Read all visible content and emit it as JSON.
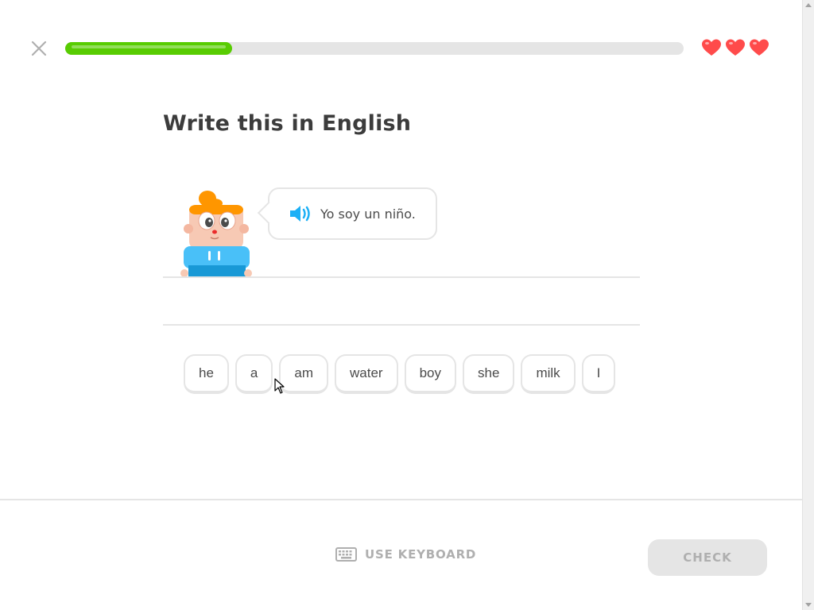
{
  "header": {
    "progress": 0.27,
    "lives": 3
  },
  "challenge": {
    "title": "Write this in English",
    "sentence": "Yo soy un niño.",
    "speaker_icon": "speaker-icon"
  },
  "word_bank": [
    "he",
    "a",
    "am",
    "water",
    "boy",
    "she",
    "milk",
    "I"
  ],
  "footer": {
    "use_keyboard_label": "USE KEYBOARD",
    "check_label": "CHECK"
  },
  "colors": {
    "progress_fill": "#58cc02",
    "progress_track": "#e5e5e5",
    "heart": "#ff4b4b",
    "speaker": "#1cb0f6",
    "disabled": "#afafaf"
  }
}
